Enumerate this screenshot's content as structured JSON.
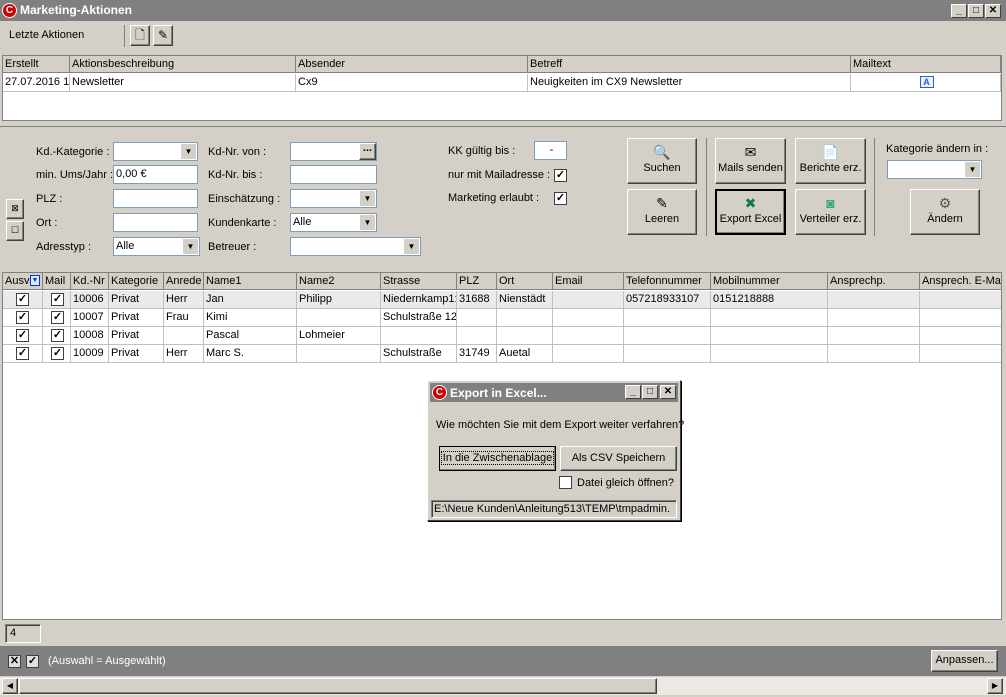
{
  "window": {
    "title": "Marketing-Aktionen",
    "logo": "C"
  },
  "toolbar": {
    "label": "Letzte Aktionen"
  },
  "top_grid": {
    "columns": [
      "Erstellt",
      "Aktionsbeschreibung",
      "Absender",
      "Betreff",
      "Mailtext"
    ],
    "rows": [
      [
        "27.07.2016 1",
        "Newsletter",
        "Cx9",
        "Neuigkeiten im CX9 Newsletter",
        ""
      ]
    ]
  },
  "filters": {
    "kd_kategorie": "Kd.-Kategorie :",
    "min_ums": "min. Ums/Jahr :",
    "min_ums_value": "0,00 €",
    "plz": "PLZ :",
    "ort": "Ort :",
    "adresstyp": "Adresstyp :",
    "adresstyp_value": "Alle",
    "kdnr_von": "Kd-Nr. von :",
    "kdnr_bis": "Kd-Nr. bis :",
    "einschaetzung": "Einschätzung :",
    "kundenkarte": "Kundenkarte :",
    "kundenkarte_value": "Alle",
    "betreuer": "Betreuer :",
    "kk_gueltig": "KK gültig bis :",
    "kk_value": "-",
    "nur_mail": "nur mit Mailadresse :",
    "marketing": "Marketing erlaubt :",
    "kategorie_aendern": "Kategorie ändern in :",
    "ellipsis": "..."
  },
  "buttons": {
    "suchen": "Suchen",
    "leeren": "Leeren",
    "mails_senden": "Mails senden",
    "export_excel": "Export Excel",
    "berichte": "Berichte erz.",
    "verteiler": "Verteiler erz.",
    "aendern": "Ändern"
  },
  "grid": {
    "columns": [
      "Ausv",
      "Mail",
      "Kd.-Nr",
      "Kategorie",
      "Anrede",
      "Name1",
      "Name2",
      "Strasse",
      "PLZ",
      "Ort",
      "Email",
      "Telefonnummer",
      "Mobilnummer",
      "Ansprechp.",
      "Ansprech. E-Ma"
    ],
    "rows": [
      {
        "kdnr": "10006",
        "kategorie": "Privat",
        "anrede": "Herr",
        "name1": "Jan",
        "name2": "Philipp",
        "strasse": "Niedernkamp1:",
        "plz": "31688",
        "ort": "Nienstädt",
        "email": "",
        "tel": "057218933107",
        "mobil": "0151218888"
      },
      {
        "kdnr": "10007",
        "kategorie": "Privat",
        "anrede": "Frau",
        "name1": "Kimi",
        "name2": "",
        "strasse": "Schulstraße 12",
        "plz": "",
        "ort": "",
        "email": "",
        "tel": "",
        "mobil": ""
      },
      {
        "kdnr": "10008",
        "kategorie": "Privat",
        "anrede": "",
        "name1": "Pascal",
        "name2": "Lohmeier",
        "strasse": "",
        "plz": "",
        "ort": "",
        "email": "",
        "tel": "",
        "mobil": ""
      },
      {
        "kdnr": "10009",
        "kategorie": "Privat",
        "anrede": "Herr",
        "name1": "Marc S.",
        "name2": "",
        "strasse": "Schulstraße",
        "plz": "31749",
        "ort": "Auetal",
        "email": "",
        "tel": "",
        "mobil": ""
      }
    ]
  },
  "dialog": {
    "title": "Export in Excel...",
    "question": "Wie möchten Sie mit dem Export weiter verfahren?",
    "btn_clipboard": "In die Zwischenablage",
    "btn_csv": "Als CSV Speichern",
    "open_label": "Datei gleich öffnen?",
    "path": "E:\\Neue Kunden\\Anleitung513\\TEMP\\tmpadmin."
  },
  "status": {
    "count": "4",
    "selection": "(Auswahl = Ausgewählt)",
    "anpassen": "Anpassen..."
  }
}
